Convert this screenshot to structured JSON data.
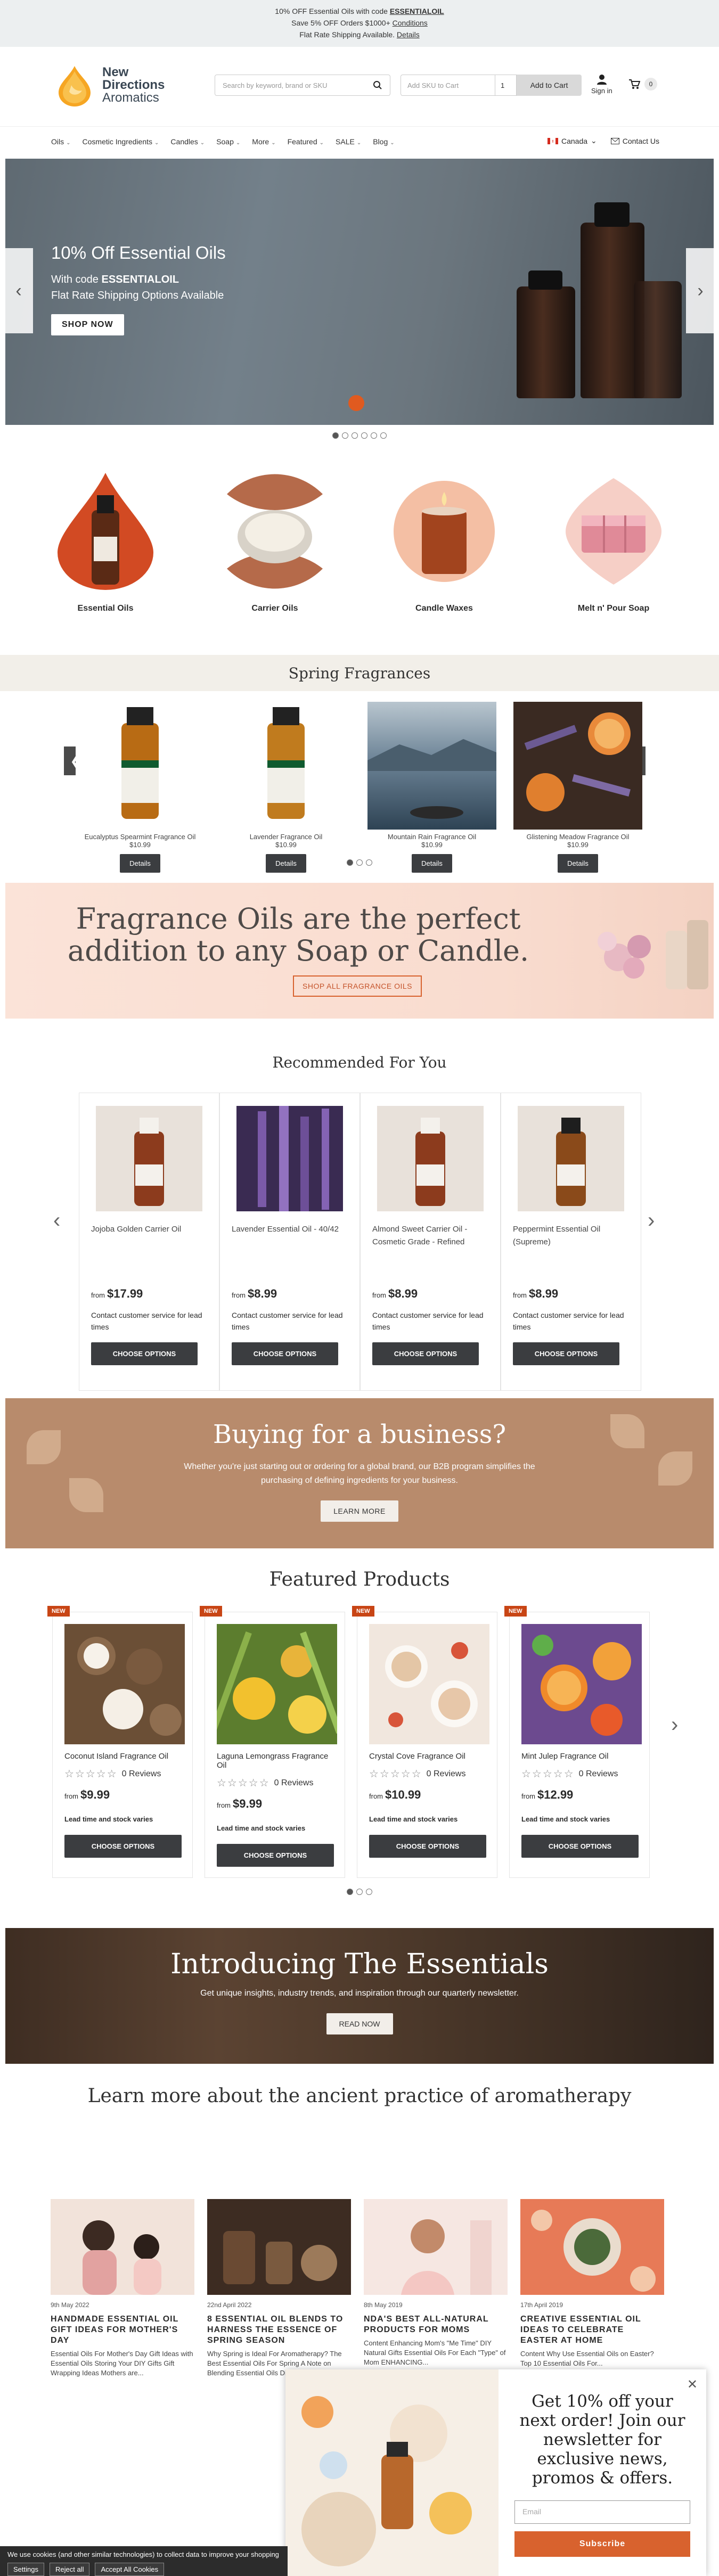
{
  "promo": {
    "line1_pre": "10% OFF Essential Oils with code ",
    "line1_code": "ESSENTIALOIL",
    "line2_pre": "Save 5% OFF Orders $1000+ ",
    "line2_link": "Conditions",
    "line3_pre": "Flat Rate Shipping Available. ",
    "line3_link": "Details"
  },
  "header": {
    "logo_line1": "New",
    "logo_line2": "Directions",
    "logo_line3": "Aromatics",
    "search_placeholder": "Search by keyword, brand or SKU",
    "sku_placeholder": "Add SKU to Cart",
    "sku_qty": "1",
    "add_to_cart": "Add to Cart",
    "signin": "Sign in",
    "cart_count": "0"
  },
  "nav": {
    "items": [
      "Oils",
      "Cosmetic Ingredients",
      "Candles",
      "Soap",
      "More",
      "Featured",
      "SALE",
      "Blog"
    ],
    "country": "Canada",
    "contact": "Contact Us"
  },
  "hero": {
    "title": "10% Off Essential Oils",
    "sub_pre": "With code ",
    "sub_code": "ESSENTIALOIL",
    "sub2": "Flat Rate Shipping Options Available",
    "button": "SHOP NOW"
  },
  "categories": [
    {
      "label": "Essential Oils"
    },
    {
      "label": "Carrier Oils"
    },
    {
      "label": "Candle Waxes"
    },
    {
      "label": "Melt n' Pour Soap"
    }
  ],
  "spring": {
    "title": "Spring Fragrances",
    "items": [
      {
        "name": "Eucalyptus Spearmint Fragrance Oil",
        "price": "$10.99",
        "button": "Details"
      },
      {
        "name": "Lavender Fragrance Oil",
        "price": "$10.99",
        "button": "Details"
      },
      {
        "name": "Mountain Rain Fragrance Oil",
        "price": "$10.99",
        "button": "Details"
      },
      {
        "name": "Glistening Meadow Fragrance Oil",
        "price": "$10.99",
        "button": "Details"
      }
    ]
  },
  "frag_banner": {
    "line1": "Fragrance Oils are the perfect",
    "line2": "addition to any Soap or Candle.",
    "button": "SHOP ALL FRAGRANCE OILS"
  },
  "recommended": {
    "title": "Recommended For You",
    "items": [
      {
        "name": "Jojoba Golden Carrier Oil",
        "from": "from",
        "price": "$17.99",
        "lead": "Contact customer service for lead times",
        "button": "CHOOSE OPTIONS"
      },
      {
        "name": "Lavender Essential Oil - 40/42",
        "from": "from",
        "price": "$8.99",
        "lead": "Contact customer service for lead times",
        "button": "CHOOSE OPTIONS"
      },
      {
        "name": "Almond Sweet Carrier Oil - Cosmetic Grade - Refined",
        "from": "from",
        "price": "$8.99",
        "lead": "Contact customer service for lead times",
        "button": "CHOOSE OPTIONS"
      },
      {
        "name": "Peppermint Essential Oil (Supreme)",
        "from": "from",
        "price": "$8.99",
        "lead": "Contact customer service for lead times",
        "button": "CHOOSE OPTIONS"
      }
    ]
  },
  "business": {
    "title": "Buying for a business?",
    "sub": "Whether you're just starting out or ordering for a global brand, our B2B program simplifies the purchasing of defining ingredients for your business.",
    "button": "LEARN MORE"
  },
  "featured": {
    "title": "Featured Products",
    "items": [
      {
        "badge": "NEW",
        "name": "Coconut Island Fragrance Oil",
        "reviews": "0 Reviews",
        "from": "from",
        "price": "$9.99",
        "lead": "Lead time and stock varies",
        "button": "CHOOSE OPTIONS"
      },
      {
        "badge": "NEW",
        "name": "Laguna Lemongrass Fragrance Oil",
        "reviews": "0 Reviews",
        "from": "from",
        "price": "$9.99",
        "lead": "Lead time and stock varies",
        "button": "CHOOSE OPTIONS"
      },
      {
        "badge": "NEW",
        "name": "Crystal Cove Fragrance Oil",
        "reviews": "0 Reviews",
        "from": "from",
        "price": "$10.99",
        "lead": "Lead time and stock varies",
        "button": "CHOOSE OPTIONS"
      },
      {
        "badge": "NEW",
        "name": "Mint Julep Fragrance Oil",
        "reviews": "0 Reviews",
        "from": "from",
        "price": "$12.99",
        "lead": "Lead time and stock varies",
        "button": "CHOOSE OPTIONS"
      }
    ]
  },
  "essentials": {
    "title": "Introducing The Essentials",
    "sub": "Get unique insights, industry trends, and inspiration through our quarterly newsletter.",
    "button": "READ NOW"
  },
  "blog": {
    "title": "Learn more about the ancient practice of aromatherapy",
    "posts": [
      {
        "date": "9th May 2022",
        "title": "HANDMADE ESSENTIAL OIL GIFT IDEAS FOR MOTHER'S DAY",
        "excerpt": "Essential Oils For Mother's Day Gift Ideas with Essential Oils Storing Your DIY Gifts Gift Wrapping Ideas Mothers are..."
      },
      {
        "date": "22nd April 2022",
        "title": "8 ESSENTIAL OIL BLENDS TO HARNESS THE ESSENCE OF SPRING SEASON",
        "excerpt": "Why Spring is Ideal For Aromatherapy? The Best Essential Oils For Spring A Note on Blending Essential Oils Diffuser Blends..."
      },
      {
        "date": "8th May 2019",
        "title": "NDA'S BEST ALL-NATURAL PRODUCTS FOR MOMS",
        "excerpt": "Content Enhancing Mom's \"Me Time\" DIY Natural Gifts Essential Oils For Each \"Type\" of Mom ENHANCING..."
      },
      {
        "date": "17th April 2019",
        "title": "CREATIVE ESSENTIAL OIL IDEAS TO CELEBRATE EASTER AT HOME",
        "excerpt": "Content Why Use Essential Oils on Easter? Top 10 Essential Oils For..."
      }
    ]
  },
  "cookie": {
    "text": "We use cookies (and other similar technologies) to collect data to improve your shopping experience.",
    "settings": "Settings",
    "reject": "Reject all",
    "accept": "Accept All Cookies"
  },
  "popup": {
    "title": "Get 10% off your next order! Join our newsletter for exclusive news, promos & offers.",
    "email_placeholder": "Email",
    "button": "Subscribe"
  },
  "colors": {
    "accent": "#d8622e",
    "dark_button": "#3b3d40",
    "business_bg": "#b88b6c",
    "promo_bg": "#eceff0"
  }
}
